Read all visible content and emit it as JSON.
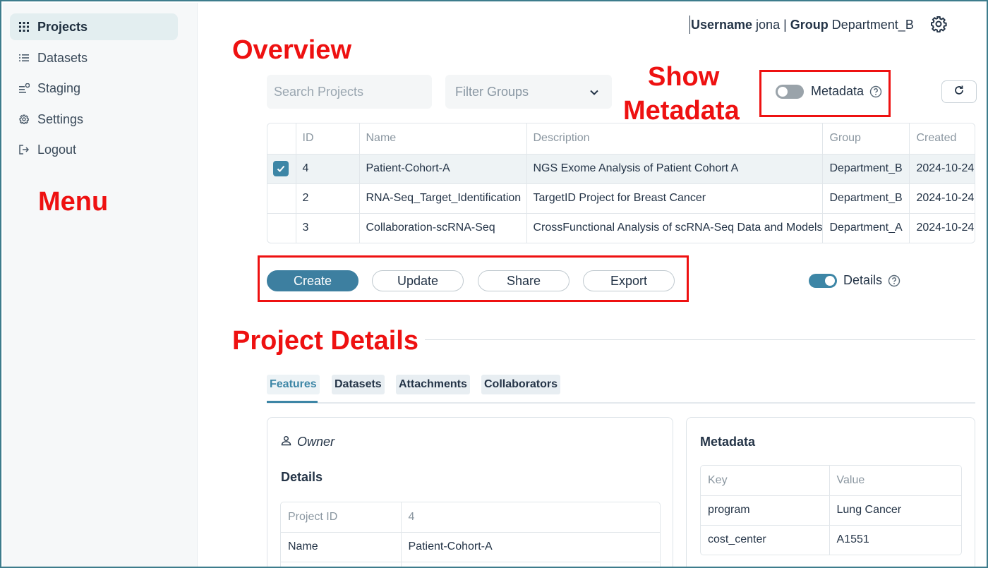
{
  "sidebar": {
    "items": [
      {
        "label": "Projects",
        "icon": "grid-icon",
        "active": true
      },
      {
        "label": "Datasets",
        "icon": "list-icon",
        "active": false
      },
      {
        "label": "Staging",
        "icon": "staging-icon",
        "active": false
      },
      {
        "label": "Settings",
        "icon": "gear-icon",
        "active": false
      },
      {
        "label": "Logout",
        "icon": "logout-icon",
        "active": false
      }
    ]
  },
  "header": {
    "username_label": "Username",
    "username": "jona",
    "separator": "|",
    "group_label": "Group",
    "group": "Department_B"
  },
  "annotations": {
    "overview": "Overview",
    "show_metadata_line1": "Show",
    "show_metadata_line2": "Metadata",
    "menu": "Menu",
    "project_details": "Project Details"
  },
  "controls": {
    "search_placeholder": "Search Projects",
    "filter_placeholder": "Filter Groups",
    "metadata_toggle_label": "Metadata",
    "metadata_toggle_on": false,
    "details_toggle_label": "Details",
    "details_toggle_on": true
  },
  "table": {
    "columns": [
      "ID",
      "Name",
      "Description",
      "Group",
      "Created"
    ],
    "rows": [
      {
        "selected": true,
        "cells": [
          "4",
          "Patient-Cohort-A",
          "NGS Exome Analysis of Patient Cohort A",
          "Department_B",
          "2024-10-24"
        ]
      },
      {
        "selected": false,
        "cells": [
          "2",
          "RNA-Seq_Target_Identification",
          "TargetID Project for Breast Cancer",
          "Department_B",
          "2024-10-24"
        ]
      },
      {
        "selected": false,
        "cells": [
          "3",
          "Collaboration-scRNA-Seq",
          "CrossFunctional Analysis of scRNA-Seq Data and Models",
          "Department_A",
          "2024-10-24"
        ]
      }
    ]
  },
  "actions": {
    "create": "Create",
    "update": "Update",
    "share": "Share",
    "export": "Export"
  },
  "details": {
    "tabs": [
      "Features",
      "Datasets",
      "Attachments",
      "Collaborators"
    ],
    "active_tab": "Features",
    "owner_label": "Owner",
    "details_title": "Details",
    "details_rows": [
      {
        "key": "Project ID",
        "value": "4"
      },
      {
        "key": "Name",
        "value": "Patient-Cohort-A"
      }
    ],
    "metadata_title": "Metadata",
    "metadata_headers": [
      "Key",
      "Value"
    ],
    "metadata_rows": [
      {
        "key": "program",
        "value": "Lung Cancer"
      },
      {
        "key": "cost_center",
        "value": "A1551"
      }
    ]
  },
  "colors": {
    "accent": "#3d86a6",
    "annotation_red": "#ee1111",
    "frame_border": "#3d7c8c"
  }
}
